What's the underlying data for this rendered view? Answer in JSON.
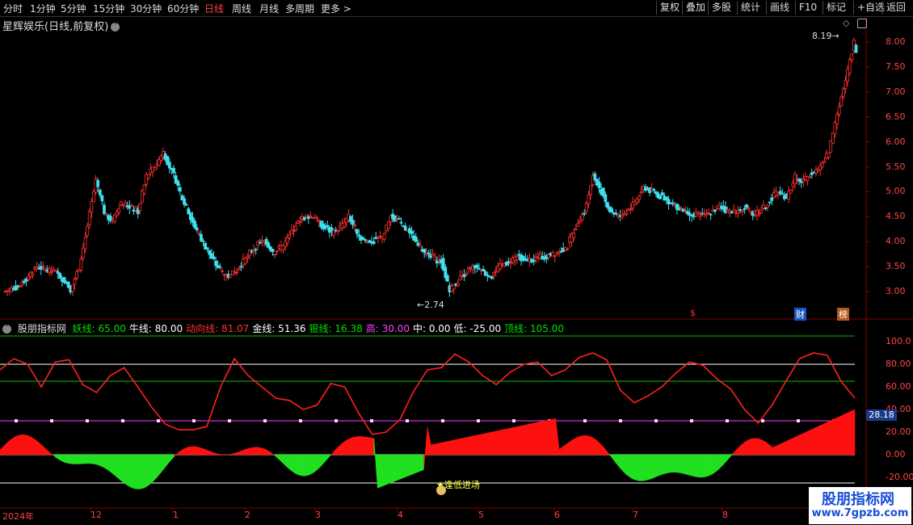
{
  "toolbar": {
    "periods": [
      "分时",
      "1分钟",
      "5分钟",
      "15分钟",
      "30分钟",
      "60分钟",
      "日线",
      "周线",
      "月线",
      "多周期",
      "更多 >"
    ],
    "active": "日线",
    "right_buttons": [
      "复权",
      "叠加",
      "多股",
      "统计",
      "画线",
      "F10",
      "标记",
      "+自选",
      "返回"
    ]
  },
  "stock": {
    "title": "星辉娱乐(日线,前复权)"
  },
  "price_axis": [
    "8.00",
    "7.50",
    "7.00",
    "6.50",
    "6.00",
    "5.50",
    "5.00",
    "4.50",
    "4.00",
    "3.50",
    "3.00"
  ],
  "annotations": {
    "high": "8.19",
    "low": "2.74",
    "signal": "逢低进场"
  },
  "badges": [
    "$",
    "财",
    "榜"
  ],
  "indicator": {
    "name": "股朋指标网",
    "items": [
      {
        "label": "妖线:",
        "value": "65.00",
        "color": "#00e000"
      },
      {
        "label": "牛线:",
        "value": "80.00",
        "color": "#ffffff"
      },
      {
        "label": "动向线:",
        "value": "81.07",
        "color": "#ff3030"
      },
      {
        "label": "金线:",
        "value": "51.36",
        "color": "#ffffff"
      },
      {
        "label": "银线:",
        "value": "16.38",
        "color": "#00e000"
      },
      {
        "label": "高:",
        "value": "30.00",
        "color": "#ff40ff"
      },
      {
        "label": "中:",
        "value": "0.00",
        "color": "#ffffff"
      },
      {
        "label": "低:",
        "value": "-25.00",
        "color": "#ffffff"
      },
      {
        "label": "顶线:",
        "value": "105.00",
        "color": "#00e000"
      }
    ]
  },
  "ind_axis": [
    "100.0",
    "80.00",
    "60.00",
    "40.00",
    "20.00",
    "0.00",
    "-20.00"
  ],
  "ind_current": "28.18",
  "dates": [
    "2024年",
    "12",
    "1",
    "2",
    "3",
    "4",
    "5",
    "6",
    "7",
    "8"
  ],
  "watermark": {
    "line1": "股朋指标网",
    "line2": "www.7gpzb.com"
  },
  "chart_data": {
    "type": "candlestick",
    "price_range": [
      2.6,
      8.4
    ],
    "close_series": [
      3.05,
      3.1,
      3.3,
      3.5,
      3.45,
      3.4,
      3.25,
      3.05,
      3.5,
      4.3,
      5.2,
      4.6,
      4.4,
      4.8,
      4.7,
      4.6,
      5.3,
      5.5,
      5.8,
      5.4,
      5.0,
      4.6,
      4.2,
      3.9,
      3.6,
      3.4,
      3.3,
      3.5,
      3.7,
      3.9,
      4.0,
      3.8,
      3.9,
      4.1,
      4.4,
      4.5,
      4.5,
      4.3,
      4.2,
      4.3,
      4.5,
      4.2,
      4.0,
      4.0,
      4.1,
      4.5,
      4.4,
      4.2,
      4.0,
      3.8,
      3.7,
      3.6,
      3.0,
      3.2,
      3.4,
      3.5,
      3.4,
      3.3,
      3.5,
      3.6,
      3.7,
      3.6,
      3.65,
      3.7,
      3.75,
      3.8,
      3.9,
      4.3,
      4.6,
      5.3,
      5.0,
      4.6,
      4.5,
      4.6,
      4.8,
      5.1,
      5.0,
      4.9,
      4.8,
      4.7,
      4.6,
      4.5,
      4.55,
      4.6,
      4.7,
      4.6,
      4.6,
      4.7,
      4.5,
      4.6,
      4.8,
      5.0,
      4.9,
      5.3,
      5.2,
      5.4,
      5.5,
      5.8,
      6.6,
      7.2,
      8.0,
      7.3
    ],
    "ind_range": [
      -30,
      110
    ],
    "dongxiang": [
      75,
      85,
      80,
      60,
      82,
      84,
      62,
      55,
      70,
      77,
      60,
      42,
      27,
      22,
      22,
      25,
      60,
      85,
      70,
      60,
      50,
      48,
      40,
      44,
      63,
      60,
      37,
      18,
      20,
      31,
      56,
      75,
      77,
      89,
      82,
      70,
      62,
      73,
      80,
      82,
      70,
      75,
      86,
      90,
      84,
      57,
      46,
      52,
      60,
      72,
      82,
      79,
      67,
      58,
      40,
      28,
      44,
      65,
      85,
      90,
      88,
      65,
      50
    ]
  }
}
